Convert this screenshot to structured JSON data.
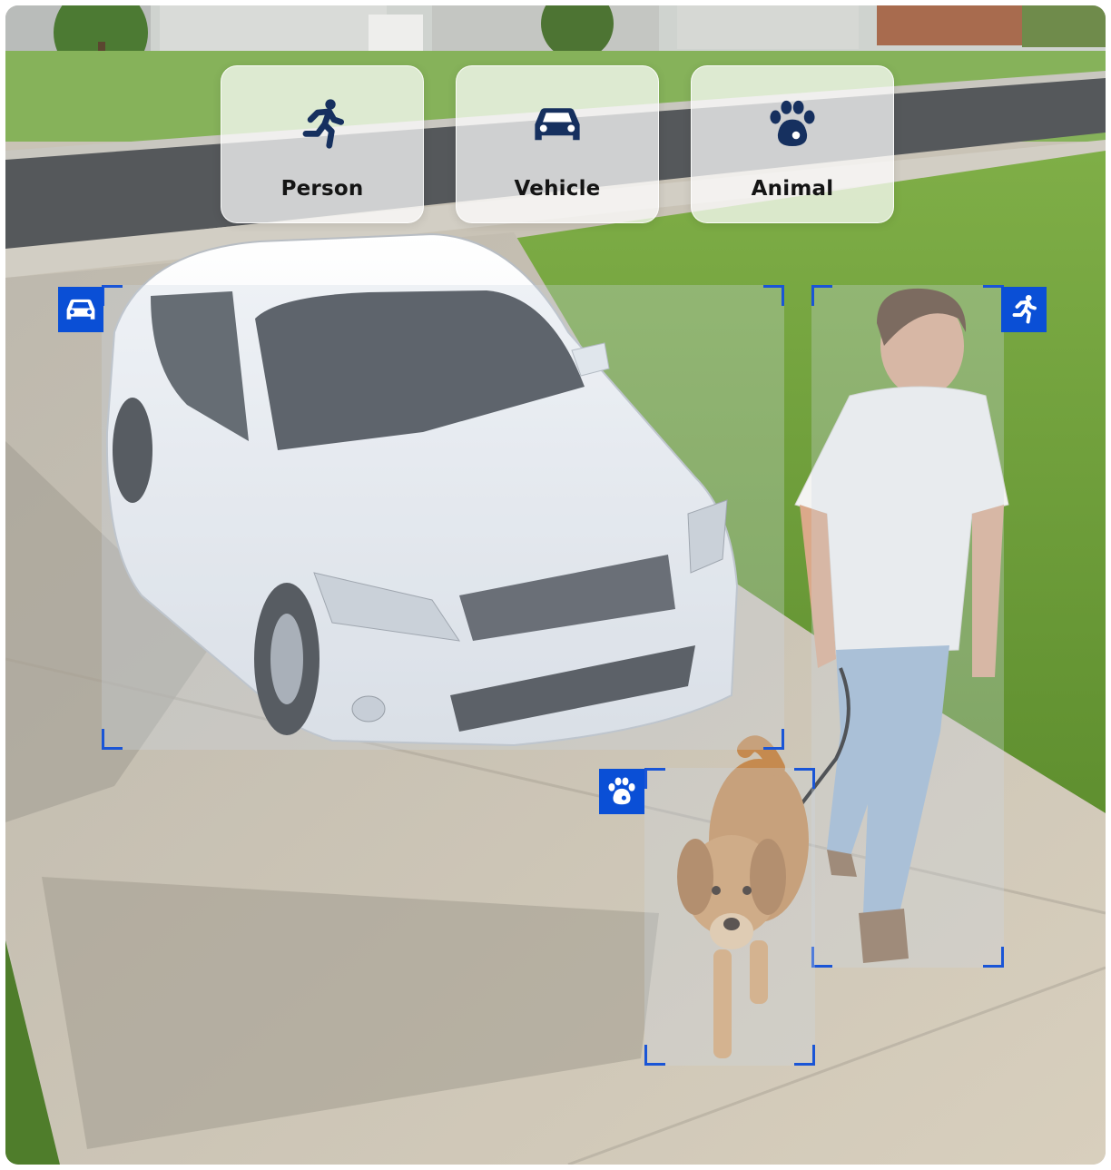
{
  "detection_types": [
    {
      "label": "Person",
      "icon": "running-person-icon"
    },
    {
      "label": "Vehicle",
      "icon": "car-icon"
    },
    {
      "label": "Animal",
      "icon": "paw-icon"
    }
  ],
  "detections": [
    {
      "type": "Vehicle",
      "icon": "car-icon"
    },
    {
      "type": "Person",
      "icon": "running-person-icon"
    },
    {
      "type": "Animal",
      "icon": "paw-icon"
    }
  ],
  "colors": {
    "icon_dark": "#16305f",
    "badge_blue": "#0a4fd6",
    "bracket_blue": "#1a55d6",
    "card_label": "#141414"
  }
}
